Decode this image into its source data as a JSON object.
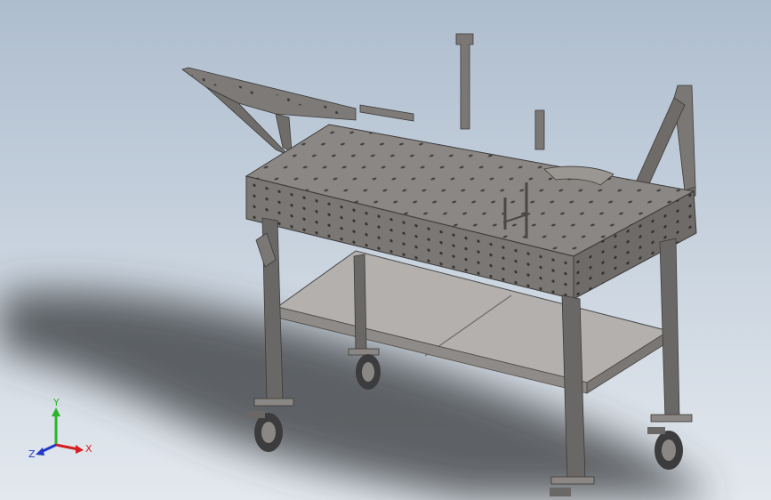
{
  "triad": {
    "x_label": "X",
    "y_label": "Y",
    "z_label": "Z",
    "colors": {
      "x": "#d62020",
      "y": "#2bb42b",
      "z": "#2438c8"
    }
  },
  "model": {
    "icon": "welding-table-3d-model",
    "colors": {
      "top": "#8a8784",
      "front": "#7a7774",
      "side": "#6e6b68",
      "leg": "#6a6866",
      "shelf": "#b3b0ad",
      "hole": "#2e2c2b",
      "shadow": "#3a3c40",
      "wheel": "#3c3c3e"
    }
  }
}
